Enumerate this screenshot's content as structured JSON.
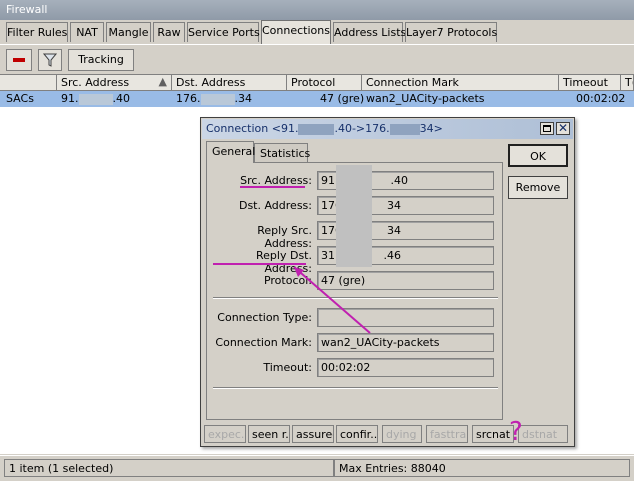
{
  "window": {
    "title": "Firewall"
  },
  "tabs": [
    "Filter Rules",
    "NAT",
    "Mangle",
    "Raw",
    "Service Ports",
    "Connections",
    "Address Lists",
    "Layer7 Protocols"
  ],
  "toolbar": {
    "tracking_label": "Tracking"
  },
  "table": {
    "headers": [
      "",
      "Src. Address",
      "Dst. Address",
      "Protocol",
      "Connection Mark",
      "Timeout",
      "T("
    ],
    "row": {
      "flag": "SACs",
      "src_pre": "91.",
      "src_post": ".40",
      "dst_pre": "176.",
      "dst_post": ".34",
      "protocol": "47 (gre)",
      "mark": "wan2_UACity-packets",
      "timeout": "00:02:02"
    }
  },
  "status": {
    "count": "1 item (1 selected)",
    "max_entries": "Max Entries: 88040"
  },
  "dialog": {
    "title_parts": [
      "Connection <91.",
      ".40->176.",
      "34>"
    ],
    "tabs": [
      "General",
      "Statistics"
    ],
    "buttons": {
      "ok": "OK",
      "remove": "Remove"
    },
    "fields": {
      "src_label": "Src. Address:",
      "src_value_pre": "91.",
      "src_value_post": ".40",
      "dst_label": "Dst. Address:",
      "dst_value_pre": "176",
      "dst_value_post": "34",
      "rsrc_label": "Reply Src. Address:",
      "rsrc_value_pre": "176",
      "rsrc_value_post": "34",
      "rdst_label": "Reply Dst. Address:",
      "rdst_value_pre": "31.",
      "rdst_value_post": ".46",
      "proto_label": "Protocol:",
      "proto_value": "47 (gre)",
      "ctype_label": "Connection Type:",
      "ctype_value": "",
      "cmark_label": "Connection Mark:",
      "cmark_value": "wan2_UACity-packets",
      "timeout_label": "Timeout:",
      "timeout_value": "00:02:02"
    },
    "flags": [
      {
        "label": "expec...",
        "on": false
      },
      {
        "label": "seen r...",
        "on": true
      },
      {
        "label": "assured",
        "on": true
      },
      {
        "label": "confir...",
        "on": true
      },
      {
        "label": "dying",
        "on": false
      },
      {
        "label": "fasttra...",
        "on": false
      },
      {
        "label": "srcnat",
        "on": true
      },
      {
        "label": "dstnat",
        "on": false
      }
    ]
  },
  "annotation": {
    "question_mark": "?",
    "color": "#c020b0"
  }
}
